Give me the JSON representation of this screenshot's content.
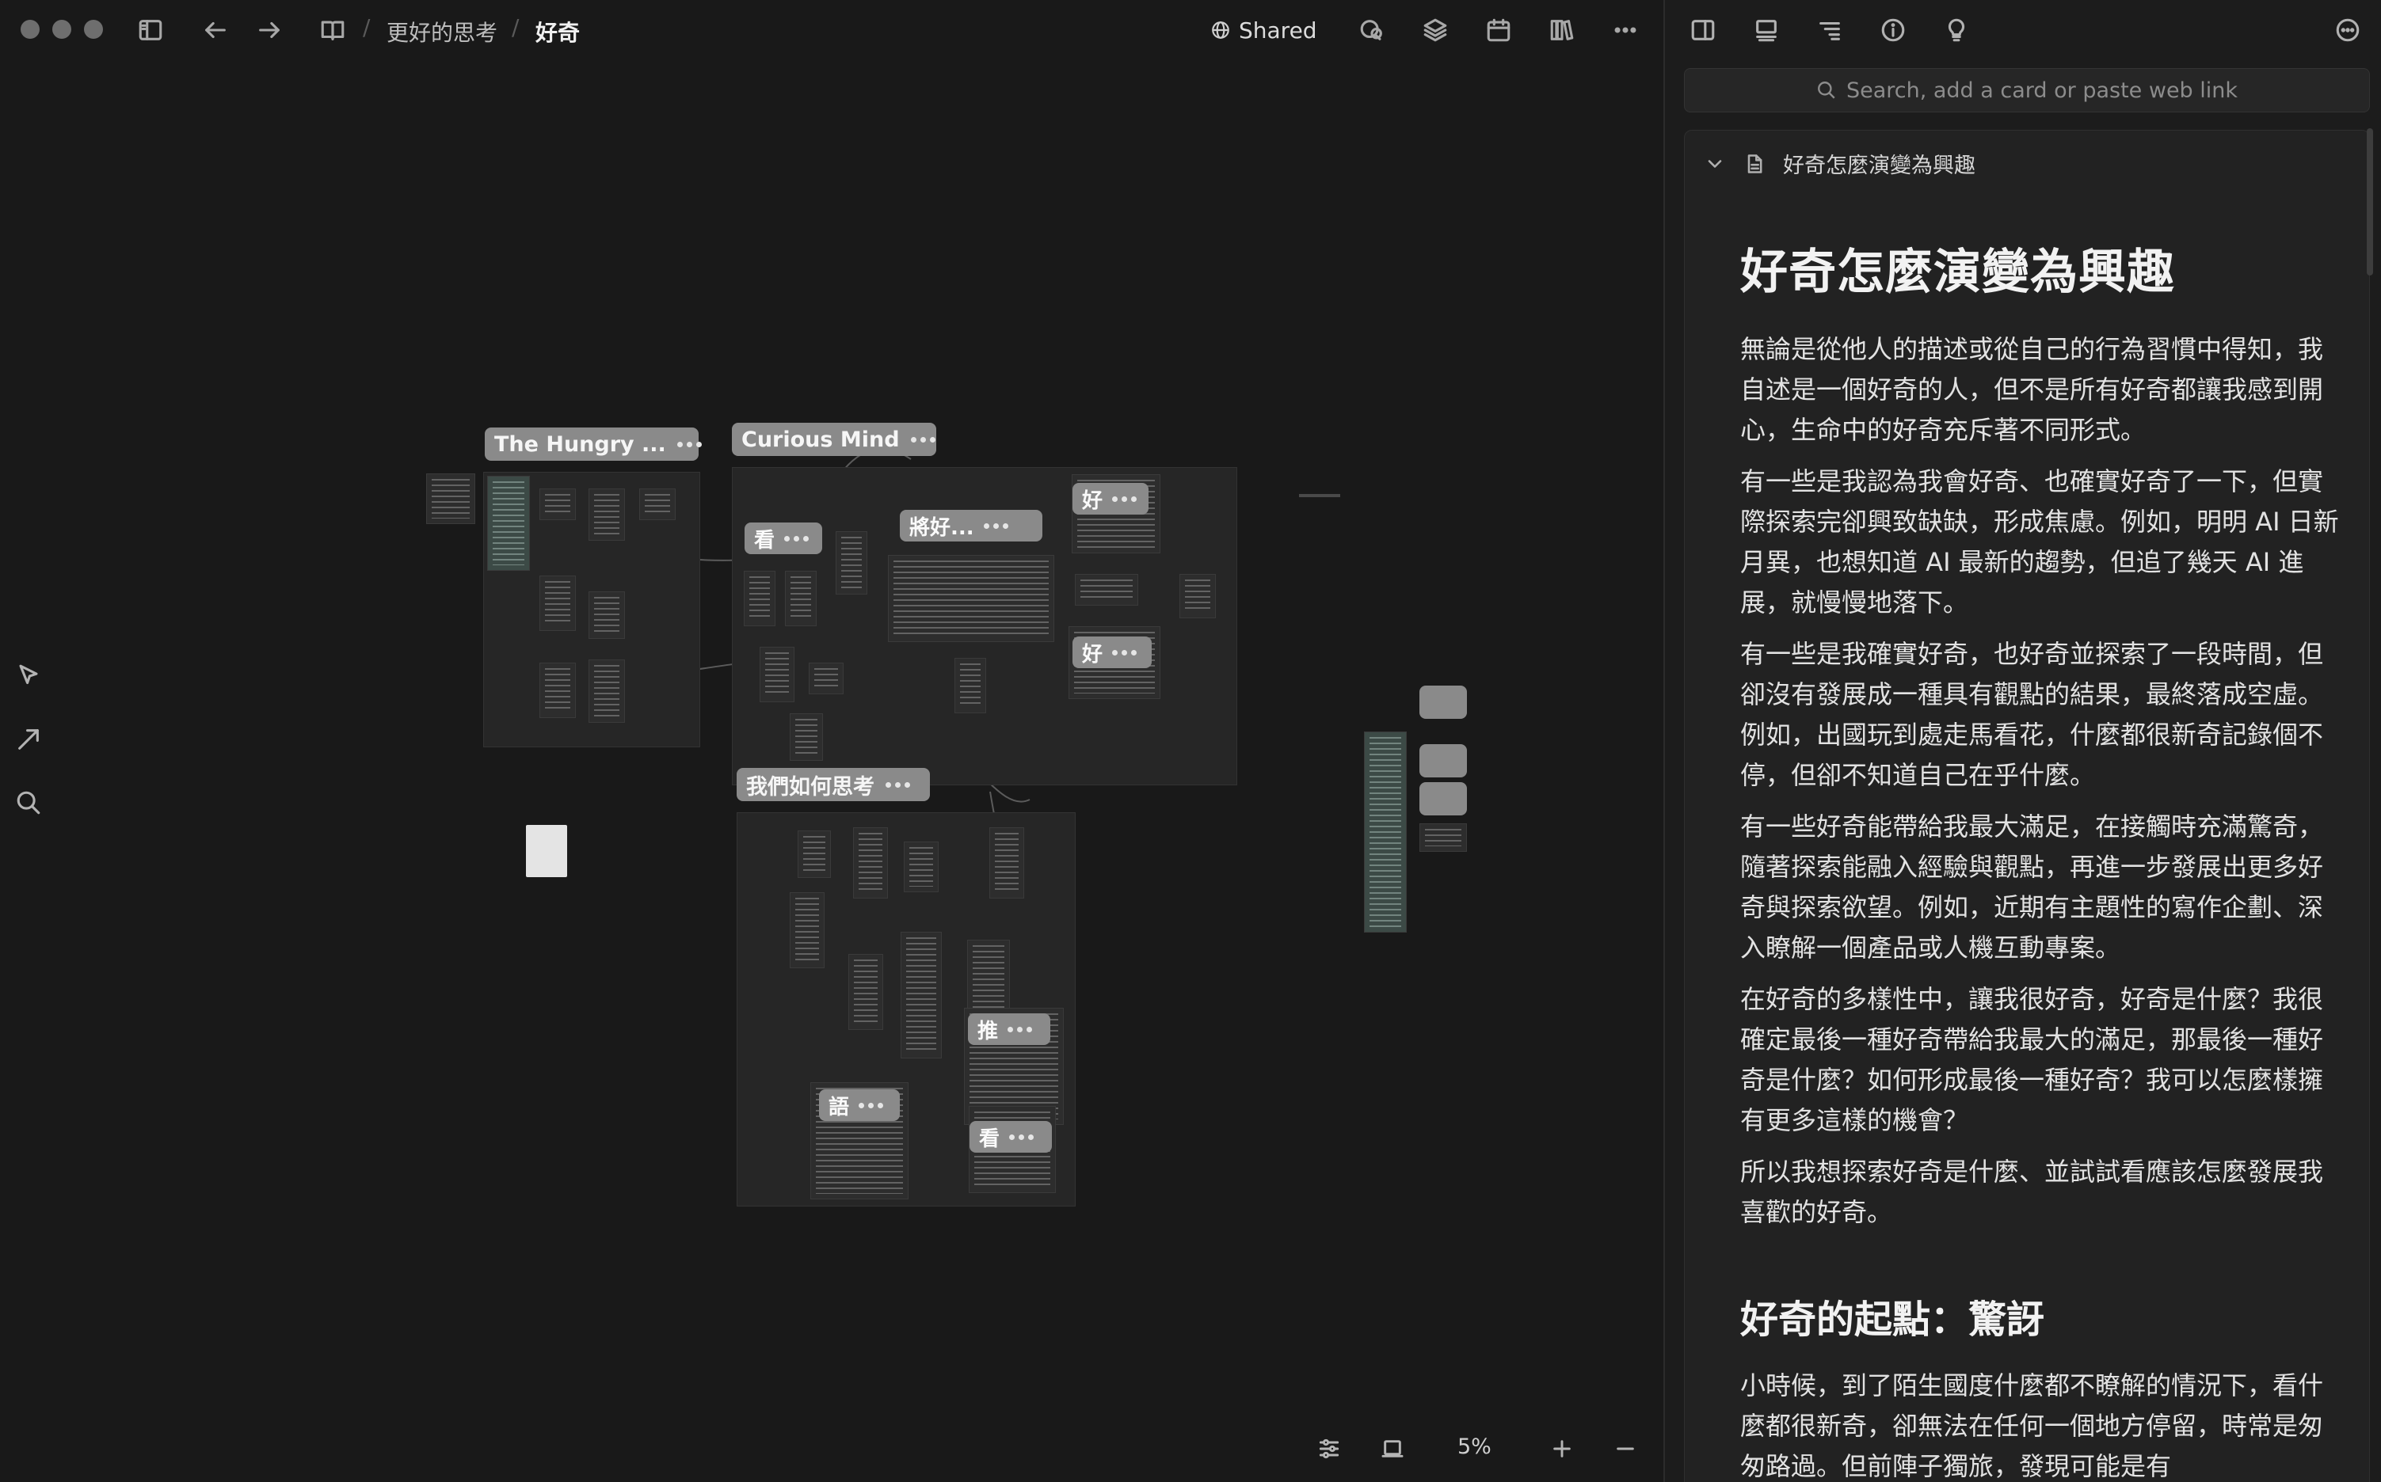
{
  "toolbar": {
    "breadcrumb_parent": "更好的思考",
    "breadcrumb_current": "好奇",
    "shared_label": "Shared"
  },
  "canvas": {
    "boards": [
      {
        "label": "The Hungry ..."
      },
      {
        "label": "Curious Mind"
      },
      {
        "label": "我們如何思考"
      }
    ],
    "pills": [
      "看",
      "將好...",
      "好",
      "好",
      "推",
      "語",
      "看"
    ],
    "zoom_level": "5%"
  },
  "panel": {
    "search_placeholder": "Search, add a card or paste web link",
    "card_title": "好奇怎麼演變為興趣",
    "doc": {
      "title": "好奇怎麼演變為興趣",
      "paragraphs": [
        "無論是從他人的描述或從自己的行為習慣中得知，我自述是一個好奇的人，但不是所有好奇都讓我感到開心，生命中的好奇充斥著不同形式。",
        "有一些是我認為我會好奇、也確實好奇了一下，但實際探索完卻興致缺缺，形成焦慮。例如，明明 AI 日新月異，也想知道 AI 最新的趨勢，但追了幾天 AI 進展，就慢慢地落下。",
        "有一些是我確實好奇，也好奇並探索了一段時間，但卻沒有發展成一種具有觀點的結果，最終落成空虛。例如，出國玩到處走馬看花，什麼都很新奇記錄個不停，但卻不知道自己在乎什麼。",
        "有一些好奇能帶給我最大滿足，在接觸時充滿驚奇，隨著探索能融入經驗與觀點，再進一步發展出更多好奇與探索欲望。例如，近期有主題性的寫作企劃、深入瞭解一個產品或人機互動專案。",
        "在好奇的多樣性中，讓我很好奇，好奇是什麼？我很確定最後一種好奇帶給我最大的滿足，那最後一種好奇是什麼？如何形成最後一種好奇？我可以怎麼樣擁有更多這樣的機會？",
        "所以我想探索好奇是什麼、並試試看應該怎麼發展我喜歡的好奇。"
      ],
      "section_title": "好奇的起點：驚訝",
      "section_paragraph": "小時候，到了陌生國度什麼都不瞭解的情況下，看什麼都很新奇，卻無法在任何一個地方停留，時常是匆匆路過。但前陣子獨旅，發現可能是有"
    }
  },
  "colors": {
    "background": "#191919",
    "board": "#262626",
    "label": "#8a8a8a",
    "teal_card": "#3c4a46"
  }
}
